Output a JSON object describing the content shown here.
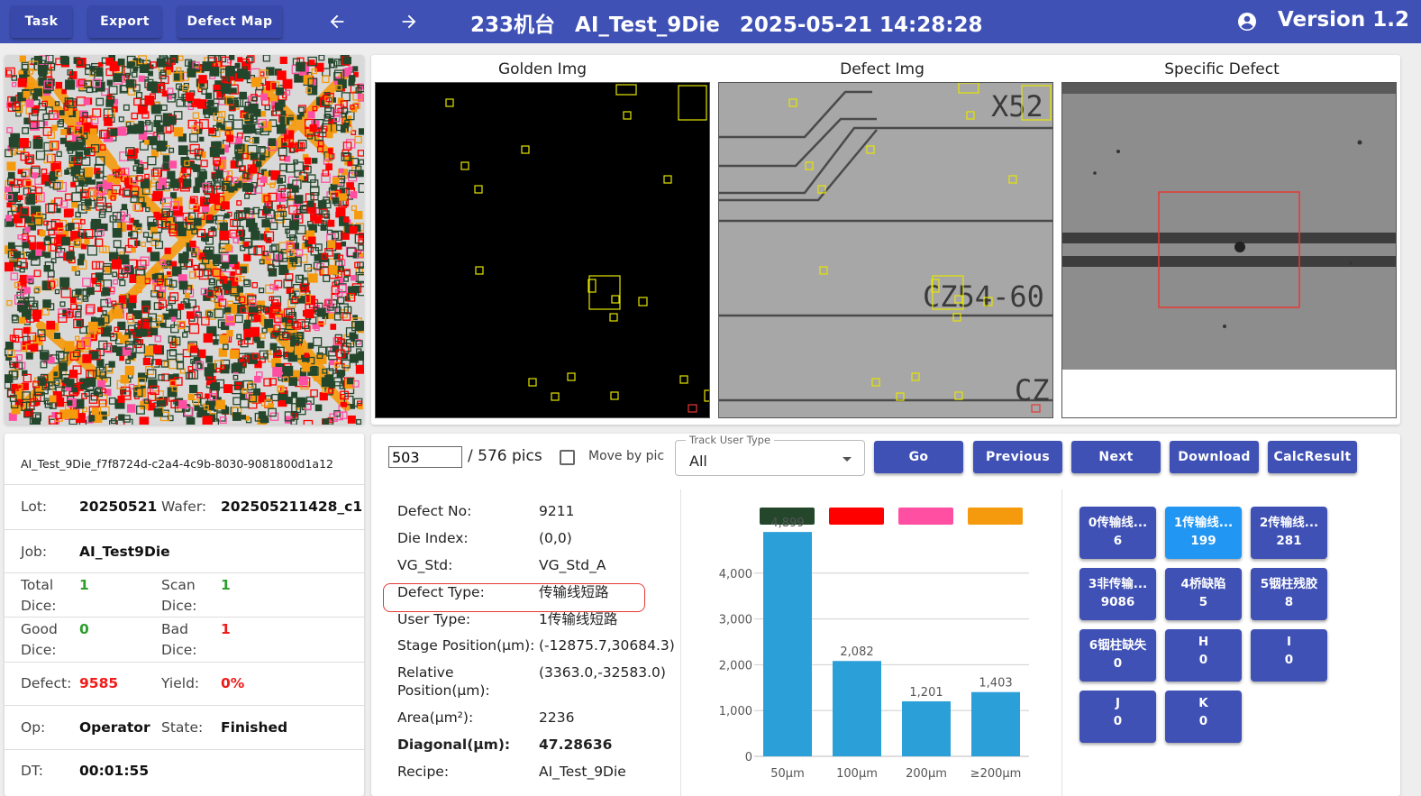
{
  "toolbar": {
    "task": "Task",
    "export": "Export",
    "defect_map": "Defect Map",
    "back_icon": "arrow-left-icon",
    "forward_icon": "arrow-right-icon",
    "machine": "233机台",
    "job": "AI_Test_9Die",
    "datetime": "2025-05-21 14:28:28",
    "user_icon": "account-circle-icon",
    "version": "Version 1.2"
  },
  "images": {
    "golden_title": "Golden Img",
    "defect_title": "Defect Img",
    "specific_title": "Specific Defect",
    "defect_img_labels": [
      "X52",
      "CZ54-60",
      "CZ"
    ]
  },
  "info": {
    "uuid": "AI_Test_9Die_f7f8724d-c2a4-4c9b-8030-9081800d1a12",
    "lot_label": "Lot:",
    "lot": "20250521",
    "wafer_label": "Wafer:",
    "wafer": "202505211428_c1",
    "job_label": "Job:",
    "job": "AI_Test9Die",
    "total_label_1": "Total",
    "total_label_2": "Dice:",
    "total": "1",
    "scan_label_1": "Scan",
    "scan_label_2": "Dice:",
    "scan": "1",
    "good_label_1": "Good",
    "good_label_2": "Dice:",
    "good": "0",
    "bad_label_1": "Bad",
    "bad_label_2": "Dice:",
    "bad": "1",
    "defect_label": "Defect:",
    "defect": "9585",
    "yield_label": "Yield:",
    "yield": "0%",
    "op_label": "Op:",
    "op": "Operator",
    "state_label": "State:",
    "state": "Finished",
    "dt_label": "DT:",
    "dt": "00:01:55"
  },
  "controls": {
    "pic_index": "503",
    "pic_total": "/ 576 pics",
    "move_by_pic": "Move by pic",
    "track_label": "Track User Type",
    "track_value": "All",
    "go": "Go",
    "previous": "Previous",
    "next": "Next",
    "download": "Download",
    "calc": "CalcResult"
  },
  "defect": {
    "no_label": "Defect No:",
    "no": "9211",
    "die_label": "Die Index:",
    "die": "(0,0)",
    "vg_label": "VG_Std:",
    "vg": "VG_Std_A",
    "type_label": "Defect Type:",
    "type": "传输线短路",
    "user_label": "User Type:",
    "user": "1传输线短路",
    "stage_label": "Stage Position(μm):",
    "stage": "(-12875.7,30684.3)",
    "rel_label_1": "Relative",
    "rel_label_2": "Position(μm):",
    "rel": "(3363.0,-32583.0)",
    "area_label": "Area(μm²):",
    "area": "2236",
    "diag_label": "Diagonal(μm):",
    "diag": "47.28636",
    "recipe_label": "Recipe:",
    "recipe": "AI_Test_9Die"
  },
  "chart_data": {
    "type": "bar",
    "categories": [
      "50μm",
      "100μm",
      "200μm",
      "≥200μm"
    ],
    "values": [
      4899,
      2082,
      1201,
      1403
    ],
    "value_labels": [
      "4,899",
      "2,082",
      "1,201",
      "1,403"
    ],
    "yticks": [
      "0",
      "1,000",
      "2,000",
      "3,000",
      "4,000"
    ],
    "ylim": [
      0,
      5000
    ],
    "bar_color": "#2a9fd8",
    "legend_colors": [
      "#24472c",
      "#ff0000",
      "#ff4fa3",
      "#f59a0c"
    ]
  },
  "categories": [
    {
      "label": "0传输线...",
      "count": "6"
    },
    {
      "label": "1传输线...",
      "count": "199",
      "active": true
    },
    {
      "label": "2传输线...",
      "count": "281"
    },
    {
      "label": "3非传输...",
      "count": "9086"
    },
    {
      "label": "4桥缺陷",
      "count": "5"
    },
    {
      "label": "5铟柱残胶",
      "count": "8"
    },
    {
      "label": "6铟柱缺失",
      "count": "0"
    },
    {
      "label": "H",
      "count": "0"
    },
    {
      "label": "I",
      "count": "0"
    },
    {
      "label": "J",
      "count": "0"
    },
    {
      "label": "K",
      "count": "0"
    }
  ]
}
